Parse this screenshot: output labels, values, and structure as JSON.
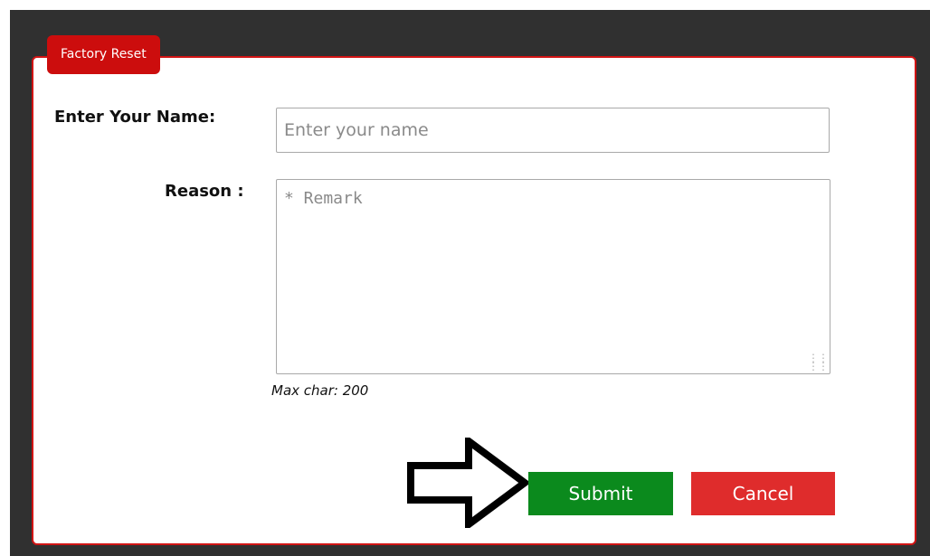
{
  "dialog": {
    "title": "Factory Reset"
  },
  "form": {
    "name_label": "Enter Your Name:",
    "name_placeholder": "Enter your name",
    "name_value": "",
    "reason_label": "Reason :",
    "reason_placeholder": "* Remark",
    "reason_value": "",
    "max_char_text": "Max char: 200"
  },
  "actions": {
    "submit_label": "Submit",
    "cancel_label": "Cancel"
  },
  "colors": {
    "title_bg": "#cc0d0d",
    "dialog_border": "#d01414",
    "submit_bg": "#0b8a1d",
    "cancel_bg": "#df2c2c",
    "backdrop": "#303030"
  },
  "annotation": {
    "icon": "arrow-right-outline-icon"
  }
}
